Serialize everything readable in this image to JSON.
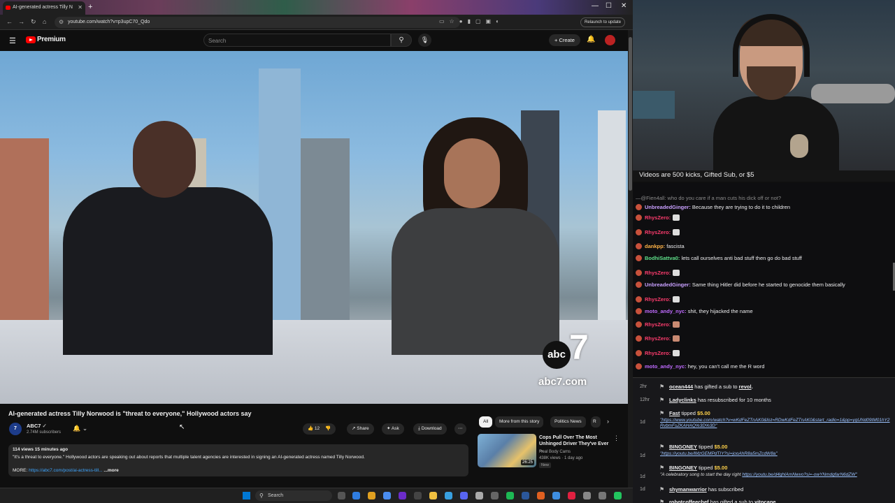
{
  "browser": {
    "tab_title": "AI-generated actress Tilly N",
    "url": "youtube.com/watch?v=p3upC70_Qdo",
    "relaunch_label": "Relaunch to update"
  },
  "youtube": {
    "brand": "Premium",
    "search_placeholder": "Search",
    "create_label": "Create",
    "video_overlay_logo": "abc",
    "video_overlay_seven": "7",
    "video_overlay_url": "abc7.com",
    "title": "AI-generated actress Tilly Norwood is \"threat to everyone,\" Hollywood actors say",
    "channel": {
      "name": "ABC7",
      "subscribers": "2.74M subscribers",
      "avatar_text": "7"
    },
    "actions": {
      "likes": "12",
      "share": "Share",
      "ask": "Ask",
      "download": "Download"
    },
    "description": {
      "meta": "114 views  15 minutes ago",
      "text": "\"It's a threat to everyone.\" Hollywood actors are speaking out about reports that multiple talent agencies are interested in signing an AI-generated actress named Tilly Norwood.",
      "more_prefix": "MORE: ",
      "more_link": "https://abc7.com/post/ai-actress-till...",
      "more_label": "...more"
    },
    "chips": [
      "All",
      "More from this story",
      "Politics News",
      "R"
    ],
    "recommendation": {
      "title": "Cops Pull Over The Most Unhinged Driver They've Ever ...",
      "channel": "Real Body Cams",
      "stats": "438K views · 1 day ago",
      "badge": "New",
      "duration": "26:25"
    }
  },
  "taskbar": {
    "search_label": "Search"
  },
  "stream": {
    "alert_text": "Videos are 500 kicks, Gifted Sub, or $5",
    "chat": [
      {
        "user": "",
        "text": "—@Fien4all: who do you care if a man cuts his dick off or not?",
        "color": "#8a8a8a",
        "emote": ""
      },
      {
        "user": "UnbreadedGinger:",
        "text": " Because they are trying to do it to children",
        "color": "#c9a0ff",
        "emote": ""
      },
      {
        "user": "RhysZero:",
        "text": "",
        "color": "#ff3c6e",
        "emote": "#ddd"
      },
      {
        "user": "RhysZero:",
        "text": "",
        "color": "#ff3c6e",
        "emote": "#ddd"
      },
      {
        "user": "dankpp:",
        "text": " fascista",
        "color": "#ffb347",
        "emote": ""
      },
      {
        "user": "BodhiSattva0:",
        "text": " lets call ourselves anti bad stuff then go do bad stuff",
        "color": "#5fe08a",
        "emote": ""
      },
      {
        "user": "RhysZero:",
        "text": "",
        "color": "#ff3c6e",
        "emote": "#ddd"
      },
      {
        "user": "UnbreadedGinger:",
        "text": " Same thing Hitler did before he started to genocide them basically",
        "color": "#c9a0ff",
        "emote": ""
      },
      {
        "user": "RhysZero:",
        "text": "",
        "color": "#ff3c6e",
        "emote": "#ddd"
      },
      {
        "user": "moto_andy_nyc:",
        "text": " shit, they hijacked the name",
        "color": "#c06bff",
        "emote": ""
      },
      {
        "user": "RhysZero:",
        "text": "",
        "color": "#ff3c6e",
        "emote": "#c98a72"
      },
      {
        "user": "RhysZero:",
        "text": "",
        "color": "#ff3c6e",
        "emote": "#c98a72"
      },
      {
        "user": "RhysZero:",
        "text": "",
        "color": "#ff3c6e",
        "emote": "#ddd"
      },
      {
        "user": "moto_andy_nyc:",
        "text": " hey, you can't call me the R word",
        "color": "#c06bff",
        "emote": ""
      }
    ],
    "events": [
      {
        "time": "2hr",
        "who": "ocean444",
        "action": " has gifted a sub to ",
        "target": "revol",
        "extra": "."
      },
      {
        "time": "12hr",
        "who": "Ladyclinks",
        "action": " has resubscribed for 10 months",
        "target": "",
        "extra": ""
      },
      {
        "time": "1d",
        "who": "Fast",
        "action": " tipped ",
        "target": "$5.00",
        "extra": "",
        "msg": "\"https://www.youtube.com/watch?v=wKdFeZTnAK0&list=RDwKdFeZTnAK0&start_radio=1&pp=ygUNd09tM01hY2RvbmFsZKAHAQ%3D%3D\""
      },
      {
        "time": "1d",
        "who": "BINGONEY",
        "action": " tipped ",
        "target": "$5.00",
        "extra": "",
        "msg": "\"https://youtu.be/lMzGEMPdTIY?si=jooAhR8a5mZcdW8a\""
      },
      {
        "time": "1d",
        "who": "BINGONEY",
        "action": " tipped ",
        "target": "$5.00",
        "extra": "",
        "msg_prefix": "\"A celebratory song to start the day right ",
        "msg": "https://youtu.be/d4ghlAmNwvo?si=-owYNmdgfarN6dZW\""
      },
      {
        "time": "1d",
        "who": "shymanwarrior",
        "action": " has subscribed",
        "target": "",
        "extra": ""
      },
      {
        "time": "",
        "who": "robotcoffeechef",
        "action": " has gifted a sub to ",
        "target": "vitocane",
        "extra": ""
      }
    ]
  }
}
